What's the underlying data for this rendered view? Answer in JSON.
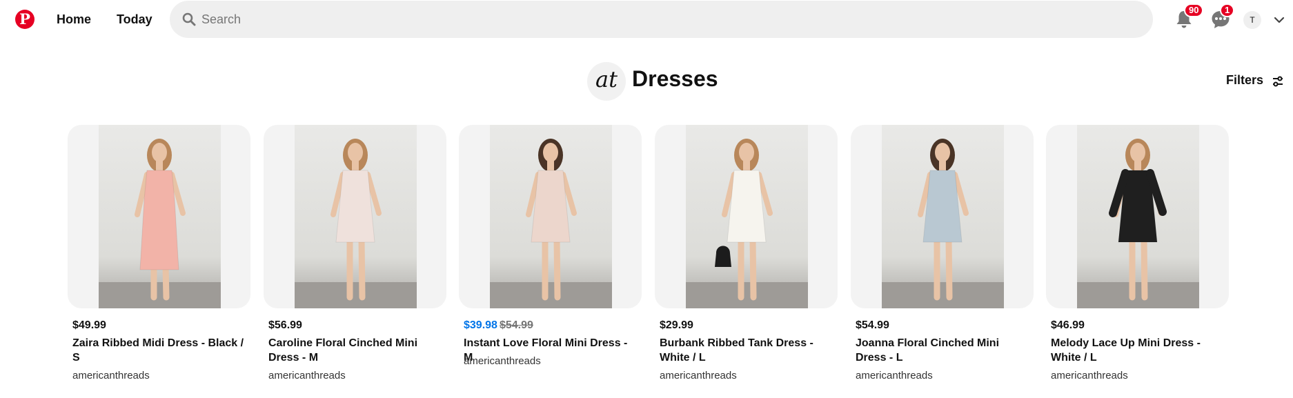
{
  "topbar": {
    "logo_letter": "P",
    "nav": [
      {
        "label": "Home"
      },
      {
        "label": "Today"
      }
    ],
    "search": {
      "placeholder": "Search",
      "value": ""
    },
    "notifications": {
      "count": "90",
      "icon": "bell-icon"
    },
    "messages": {
      "count": "1",
      "icon": "chat-icon"
    },
    "account": {
      "initial": "T",
      "icon": "chevron-down-icon"
    }
  },
  "board": {
    "avatar_text": "at",
    "title": "Dresses",
    "filters_label": "Filters"
  },
  "colors": {
    "brand": "#e60023",
    "sale_price": "#0074e8"
  },
  "products": [
    {
      "price": "$49.99",
      "title": "Zaira Ribbed Midi Dress - Black / S",
      "seller": "americanthreads",
      "dress_color": "#f2b3a8"
    },
    {
      "price": "$56.99",
      "title": "Caroline Floral Cinched Mini Dress - M",
      "seller": "americanthreads",
      "dress_color": "#efe1dc"
    },
    {
      "sale_price": "$39.98",
      "original_price": "$54.99",
      "title": "Instant Love Floral Mini Dress - M",
      "seller": "americanthreads",
      "dress_color": "#ecd6cc"
    },
    {
      "price": "$29.99",
      "title": "Burbank Ribbed Tank Dress - White / L",
      "seller": "americanthreads",
      "dress_color": "#f6f4ee"
    },
    {
      "price": "$54.99",
      "title": "Joanna Floral Cinched Mini Dress - L",
      "seller": "americanthreads",
      "dress_color": "#b9c8d2"
    },
    {
      "price": "$46.99",
      "title": "Melody Lace Up Mini Dress - White / L",
      "seller": "americanthreads",
      "dress_color": "#1f1f1f"
    }
  ]
}
